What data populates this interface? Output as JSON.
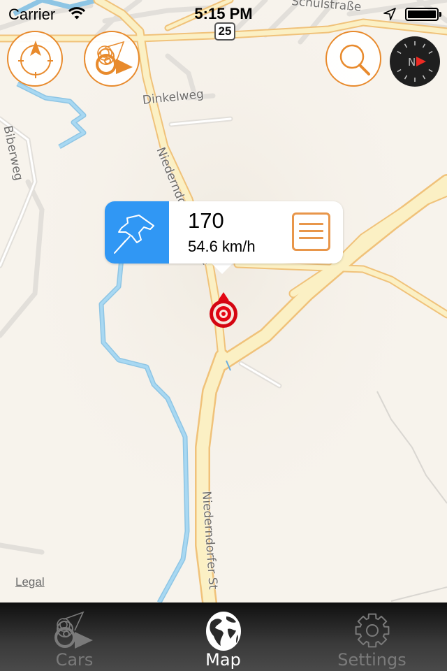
{
  "status_bar": {
    "carrier": "Carrier",
    "time": "5:15 PM",
    "wifi_icon": "wifi-icon",
    "location_icon": "location-arrow-icon",
    "battery_level": 1.0
  },
  "map": {
    "route_shield": "25",
    "street_labels": [
      {
        "name": "Schulstraße"
      },
      {
        "name": "Dinkelweg"
      },
      {
        "name": "Biberweg"
      },
      {
        "name": "Niederndorfer Straße"
      },
      {
        "name": "Niederndorfer St"
      }
    ],
    "legal_link": "Legal",
    "colors": {
      "background": "#f7f3ec",
      "major_road_fill": "#fbf0c4",
      "major_road_edge": "#f0c37a",
      "river": "#9fd0ec",
      "minor_road": "#e3e1dd"
    }
  },
  "controls": {
    "locate_button_icon": "crosshair-location-icon",
    "cars_overview_button_icon": "cars-pin-icon",
    "search_button_icon": "search-icon",
    "compass": {
      "icon": "compass-icon",
      "heading_label": "N"
    },
    "accent_color": "#e88a2c"
  },
  "callout": {
    "title": "170",
    "subtitle": "54.6 km/h",
    "pin_icon": "pushpin-icon",
    "list_icon": "list-icon",
    "pin_bg_color": "#3097f4"
  },
  "marker": {
    "icon": "target-marker-icon",
    "color": "#e30613"
  },
  "tab_bar": {
    "tabs": [
      {
        "label": "Cars",
        "icon": "cars-icon",
        "active": false
      },
      {
        "label": "Map",
        "icon": "globe-icon",
        "active": true
      },
      {
        "label": "Settings",
        "icon": "gear-icon",
        "active": false
      }
    ]
  }
}
